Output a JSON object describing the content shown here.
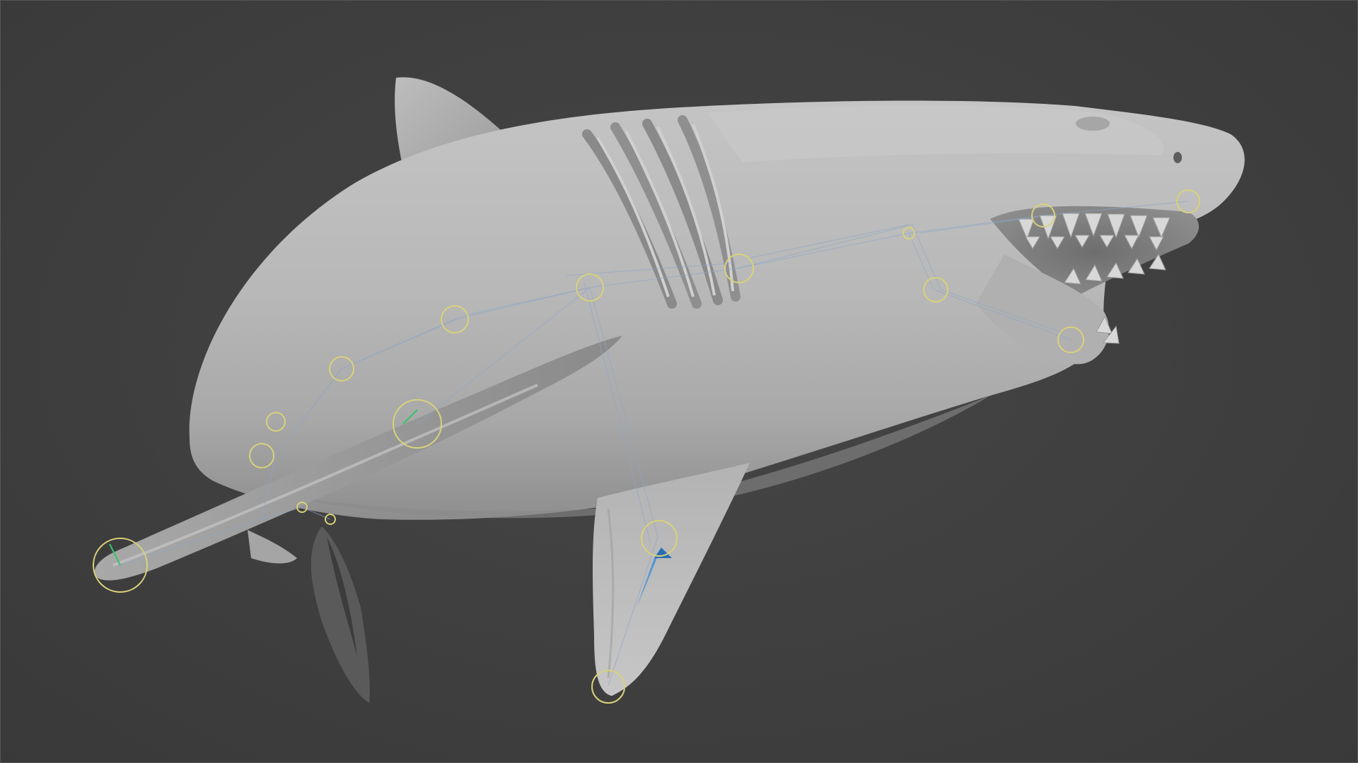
{
  "viewport": {
    "background_color": "#3f3f3f",
    "model": "shark-mesh",
    "mesh_color": "#b9b9b9",
    "rig_line_color": "#8fa6c8",
    "joint_ring_color": "#d8d27a",
    "selected_bone_color": "#3f8fd8",
    "axis_green_color": "#38c46a"
  }
}
